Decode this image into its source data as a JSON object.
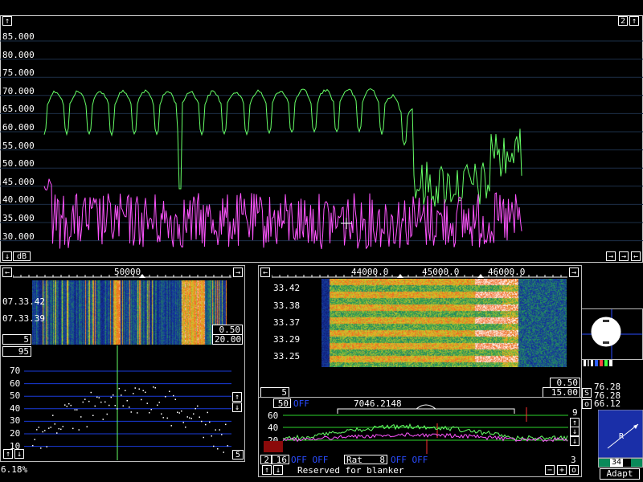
{
  "colors": {
    "green": "#66ff66",
    "magenta": "#ff55ff",
    "grid": "#1d2f48",
    "blue": "#2a4cff",
    "red": "#ff3030"
  },
  "top_spectrum": {
    "corner_right": "2",
    "y_labels": [
      "85.000",
      "80.000",
      "75.000",
      "70.000",
      "65.000",
      "60.000",
      "55.000",
      "50.000",
      "45.000",
      "40.000",
      "35.000",
      "30.000"
    ],
    "unit_button": "dB"
  },
  "waterfall_left": {
    "freq": "50000",
    "times": [
      "07.33.42",
      "07.33.39"
    ],
    "box_top": "0.50",
    "box_bottom": "20.00",
    "count_left": "5",
    "count_box": "95"
  },
  "lower_left": {
    "y_labels": [
      "70",
      "60",
      "50",
      "40",
      "30",
      "20",
      "10"
    ],
    "count_right": "5",
    "percent": "6.18%"
  },
  "waterfall_right": {
    "freqs": [
      "44000.0",
      "45000.0",
      "46000.0"
    ],
    "times": [
      "33.42",
      "33.38",
      "33.37",
      "33.29",
      "33.25"
    ],
    "box_top": "0.50",
    "box_bottom": "15.00",
    "count_left": "5",
    "s_button": "S"
  },
  "lower_right": {
    "count_box": "50",
    "dim_label": "OFF",
    "freq_readout": "7046.2148",
    "y_labels": [
      "60",
      "40",
      "20"
    ],
    "right_top": "9",
    "btn_2": "2",
    "btn_16": "16",
    "dim_row": "OFF OFF",
    "rat_label": "Rat",
    "rat_value": "8",
    "dim_row2": "OFF OFF",
    "right_bottom": "3",
    "status": "Reserved for blanker"
  },
  "side_panel": {
    "o_button": "o",
    "values": [
      "76.28",
      "76.28",
      "66.12"
    ],
    "badge": "34",
    "adapt_button": "Adapt",
    "compass_letter": "R"
  }
}
